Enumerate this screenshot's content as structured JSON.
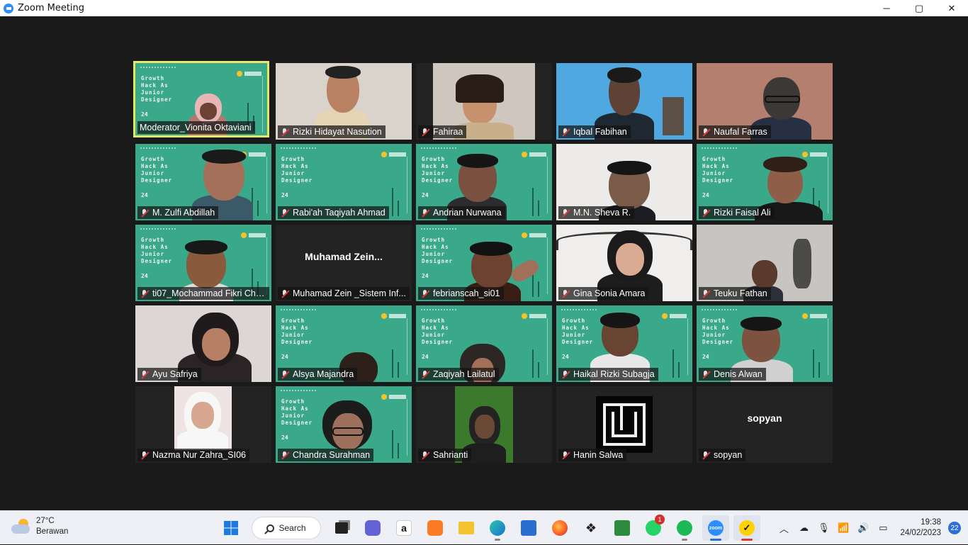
{
  "window": {
    "title": "Zoom Meeting",
    "minimize": "─",
    "maximize": "▢",
    "close": "✕"
  },
  "tiles": [
    {
      "name": "Moderator_Vionita Oktaviani",
      "muted": false,
      "bg": "slide"
    },
    {
      "name": "Rizki Hidayat Nasution",
      "muted": true,
      "bg": "camera"
    },
    {
      "name": "Fahiraa",
      "muted": true,
      "bg": "camera"
    },
    {
      "name": "Iqbal Fabihan",
      "muted": true,
      "bg": "camera"
    },
    {
      "name": "Naufal Farras",
      "muted": true,
      "bg": "camera"
    },
    {
      "name": "M. Zulfi Abdillah",
      "muted": true,
      "bg": "slide"
    },
    {
      "name": "Rabi'ah Taqiyah Ahmad",
      "muted": true,
      "bg": "slide"
    },
    {
      "name": "Andrian Nurwana",
      "muted": true,
      "bg": "slide"
    },
    {
      "name": "M.N. Sheva R.",
      "muted": true,
      "bg": "camera"
    },
    {
      "name": "Rizki Faisal Ali",
      "muted": true,
      "bg": "slide"
    },
    {
      "name": "ti07_Mochammad Fikri Cha...",
      "muted": true,
      "bg": "slide"
    },
    {
      "name": "Muhamad Zein _Sistem Inf...",
      "muted": true,
      "bg": "off",
      "big": "Muhamad  Zein..."
    },
    {
      "name": "febrianscah_si01",
      "muted": true,
      "bg": "slide"
    },
    {
      "name": "Gina Sonia Amara",
      "muted": true,
      "bg": "camera"
    },
    {
      "name": "Teuku Fathan",
      "muted": true,
      "bg": "camera"
    },
    {
      "name": "Ayu Safriya",
      "muted": true,
      "bg": "camera"
    },
    {
      "name": "Alsya Majandra",
      "muted": true,
      "bg": "slide"
    },
    {
      "name": "Zaqiyah Lailatul",
      "muted": true,
      "bg": "slide"
    },
    {
      "name": "Haikal Rizki Subagja",
      "muted": true,
      "bg": "slide"
    },
    {
      "name": "Denis Alwan",
      "muted": true,
      "bg": "slide"
    },
    {
      "name": "Nazma Nur Zahra_SI06",
      "muted": true,
      "bg": "camera"
    },
    {
      "name": "Chandra Surahman",
      "muted": true,
      "bg": "slide"
    },
    {
      "name": "Sahrianti",
      "muted": true,
      "bg": "camera"
    },
    {
      "name": "Hanin Salwa",
      "muted": true,
      "bg": "avatar"
    },
    {
      "name": "sopyan",
      "muted": true,
      "bg": "off",
      "big": "sopyan"
    }
  ],
  "slide": {
    "title_lines": [
      "Growth",
      "Hack As",
      "Junior",
      "Designer"
    ],
    "number": "24"
  },
  "taskbar": {
    "weather_temp": "27°C",
    "weather_desc": "Berawan",
    "search_label": "Search",
    "whatsapp_badge": "1",
    "time": "19:38",
    "date": "24/02/2023",
    "notification_count": "22"
  },
  "colors": {
    "slide_green": "#3aa98a",
    "active_border": "#e5e86a",
    "mute_red": "#e03a3a",
    "zoom_blue": "#2d8cff"
  }
}
